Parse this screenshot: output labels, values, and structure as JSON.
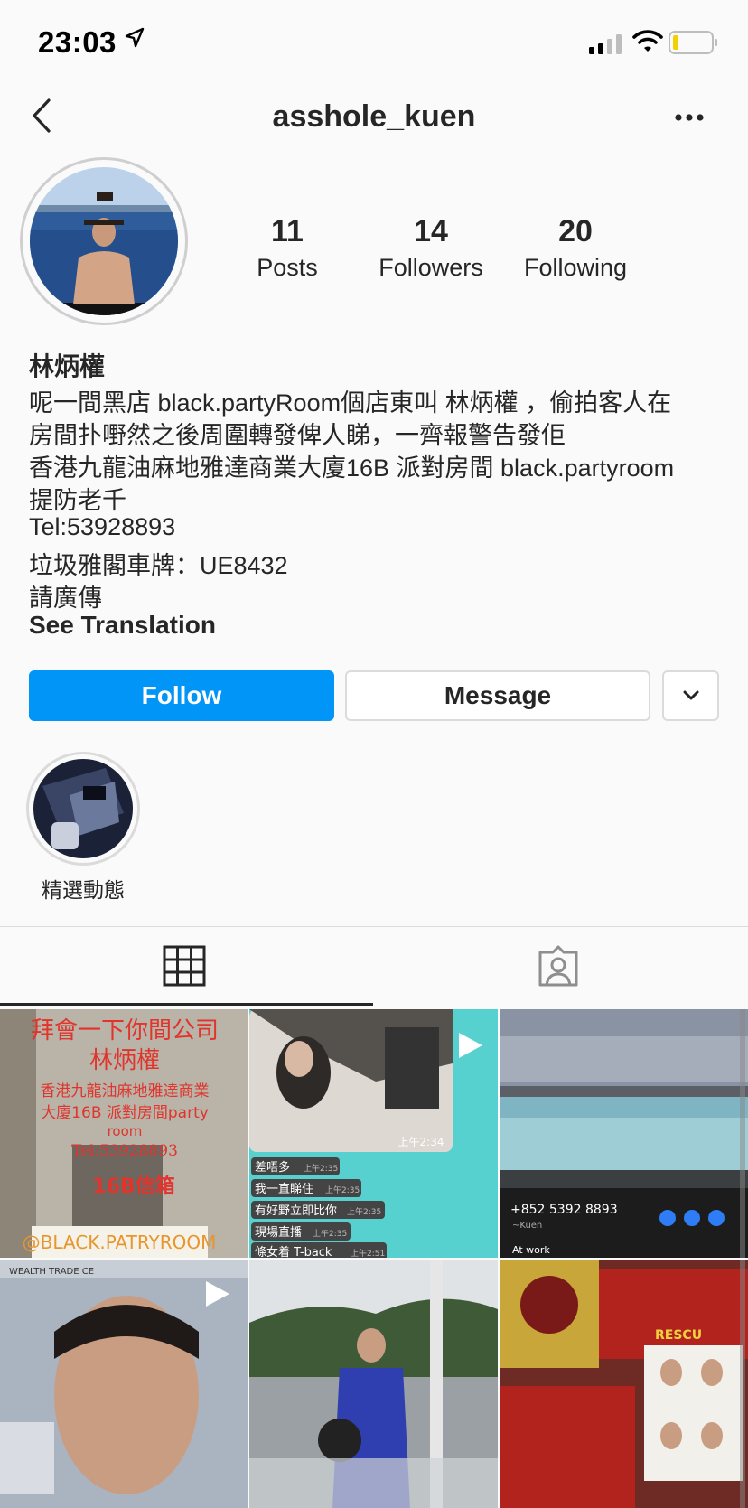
{
  "status_bar": {
    "time": "23:03",
    "icons": [
      "location-arrow-icon",
      "signal-icon",
      "wifi-icon",
      "battery-icon"
    ]
  },
  "header": {
    "username": "asshole_kuen",
    "back_icon": "chevron-left-icon",
    "more_icon": "ellipsis-icon"
  },
  "stats": [
    {
      "value": "11",
      "label": "Posts"
    },
    {
      "value": "14",
      "label": "Followers"
    },
    {
      "value": "20",
      "label": "Following"
    }
  ],
  "profile": {
    "name": "林炳權",
    "bio_lines": [
      "呢一間黑店 black.partyRoom個店東叫 林炳權 ，偷拍客人在",
      "房間扑嘢然之後周圍轉發俾人睇，一齊報警告發佢",
      "香港九龍油麻地雅達商業大廈16B 派對房間 black.partyroom",
      "提防老千",
      "Tel:53928893",
      "垃圾雅閣車牌：UE8432",
      "請廣傳"
    ],
    "see_translation": "See Translation"
  },
  "actions": {
    "follow": "Follow",
    "message": "Message"
  },
  "highlight": {
    "label": "精選動態"
  },
  "tabs": [
    "grid-icon",
    "tagged-icon"
  ],
  "posts": {
    "post1": {
      "lines": [
        "拜會一下你間公司",
        "林炳權",
        "香港九龍油麻地雅達商業",
        "大廈16B 派對房間party",
        "room",
        "Tel:53928893",
        "16B信箱"
      ],
      "tag": "@BLACK.PATRYROOM"
    },
    "post2": {
      "time_main": "上午2:34",
      "messages": [
        {
          "text": "差唔多",
          "time": "上午2:35"
        },
        {
          "text": "我一直睇住",
          "time": "上午2:35"
        },
        {
          "text": "有好野立即比你",
          "time": "上午2:35"
        },
        {
          "text": "現場直播",
          "time": "上午2:35"
        },
        {
          "text": "條女着 T-back",
          "time": "上午2:51"
        }
      ]
    },
    "post3": {
      "phone": "+852 5392 8893",
      "sub": "~Kuen",
      "status": "At work"
    },
    "post4": {
      "sign": "WEALTH TRADE CE"
    },
    "post6": {
      "rescue": "RESCU"
    }
  },
  "colors": {
    "accent": "#0095f6",
    "border": "#dbdbdb",
    "text": "#262626"
  }
}
